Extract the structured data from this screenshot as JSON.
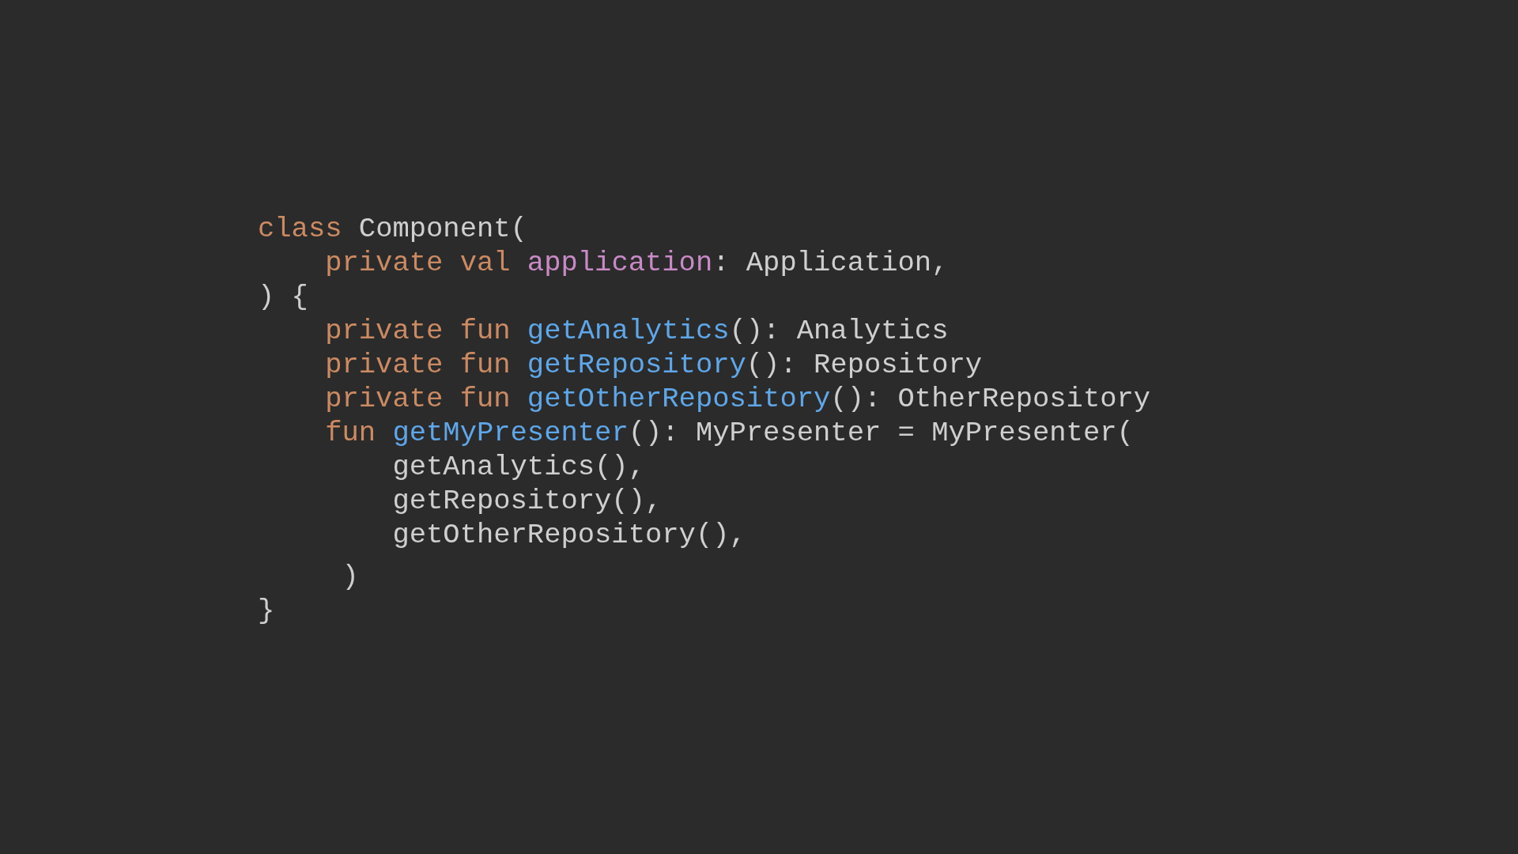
{
  "code_lines": [
    {
      "tokens": [
        {
          "kind": "keyword",
          "text": "class"
        },
        {
          "kind": "plain",
          "text": " Component("
        }
      ]
    },
    {
      "tokens": [
        {
          "kind": "keyword",
          "text": "    private val "
        },
        {
          "kind": "property",
          "text": "application"
        },
        {
          "kind": "plain",
          "text": ": Application,"
        }
      ]
    },
    {
      "tokens": [
        {
          "kind": "plain",
          "text": ") {"
        }
      ]
    },
    {
      "tokens": [
        {
          "kind": "keyword",
          "text": "    private fun "
        },
        {
          "kind": "function",
          "text": "getAnalytics"
        },
        {
          "kind": "plain",
          "text": "(): Analytics"
        }
      ]
    },
    {
      "tokens": [
        {
          "kind": "keyword",
          "text": "    private fun "
        },
        {
          "kind": "function",
          "text": "getRepository"
        },
        {
          "kind": "plain",
          "text": "(): Repository"
        }
      ]
    },
    {
      "tokens": [
        {
          "kind": "keyword",
          "text": "    private fun "
        },
        {
          "kind": "function",
          "text": "getOtherRepository"
        },
        {
          "kind": "plain",
          "text": "(): OtherRepository"
        }
      ]
    },
    {
      "tokens": [
        {
          "kind": "keyword",
          "text": "    fun "
        },
        {
          "kind": "function",
          "text": "getMyPresenter"
        },
        {
          "kind": "plain",
          "text": "(): MyPresenter = MyPresenter("
        }
      ]
    },
    {
      "tokens": [
        {
          "kind": "plain",
          "text": "        getAnalytics(),"
        }
      ]
    },
    {
      "tokens": [
        {
          "kind": "plain",
          "text": "        getRepository(),"
        }
      ]
    },
    {
      "tokens": [
        {
          "kind": "plain",
          "text": "        getOtherRepository(),"
        }
      ]
    },
    {
      "tokens": [
        {
          "kind": "plain",
          "text": "     )"
        }
      ]
    },
    {
      "tokens": [
        {
          "kind": "plain",
          "text": "}"
        }
      ]
    }
  ]
}
